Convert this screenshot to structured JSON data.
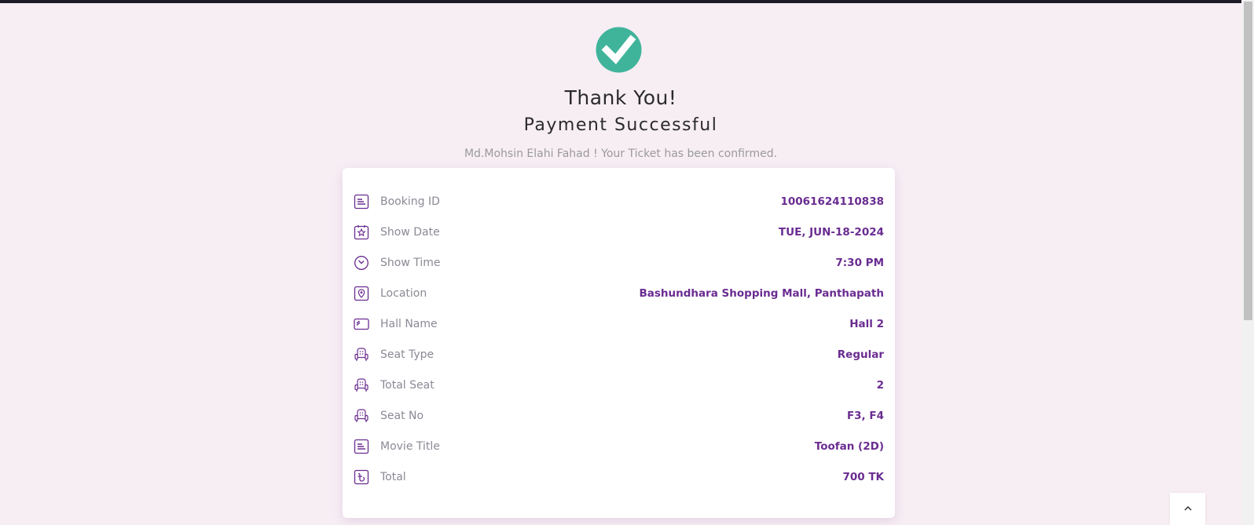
{
  "header": {
    "title": "Thank You!",
    "subtitle": "Payment Successful",
    "message": "Md.Mohsin Elahi Fahad ! Your Ticket has been confirmed."
  },
  "colors": {
    "accent": "#6a2c91",
    "success": "#40b49b",
    "background": "#f7eef4"
  },
  "ticket": {
    "rows": [
      {
        "icon": "list-icon",
        "label": "Booking ID",
        "value": "10061624110838"
      },
      {
        "icon": "calendar-star-icon",
        "label": "Show Date",
        "value": "TUE, JUN-18-2024"
      },
      {
        "icon": "clock-icon",
        "label": "Show Time",
        "value": "7:30 PM"
      },
      {
        "icon": "location-pin-icon",
        "label": "Location",
        "value": "Bashundhara Shopping Mall, Panthapath"
      },
      {
        "icon": "ticket-icon",
        "label": "Hall Name",
        "value": "Hall 2"
      },
      {
        "icon": "seat-icon",
        "label": "Seat Type",
        "value": "Regular"
      },
      {
        "icon": "seat-icon",
        "label": "Total Seat",
        "value": "2"
      },
      {
        "icon": "seat-icon",
        "label": "Seat No",
        "value": "F3, F4"
      },
      {
        "icon": "list-icon",
        "label": "Movie Title",
        "value": "Toofan (2D)"
      },
      {
        "icon": "taka-icon",
        "label": "Total",
        "value": "700 TK"
      }
    ]
  },
  "back_to_top": {
    "icon": "chevron-up-icon"
  }
}
